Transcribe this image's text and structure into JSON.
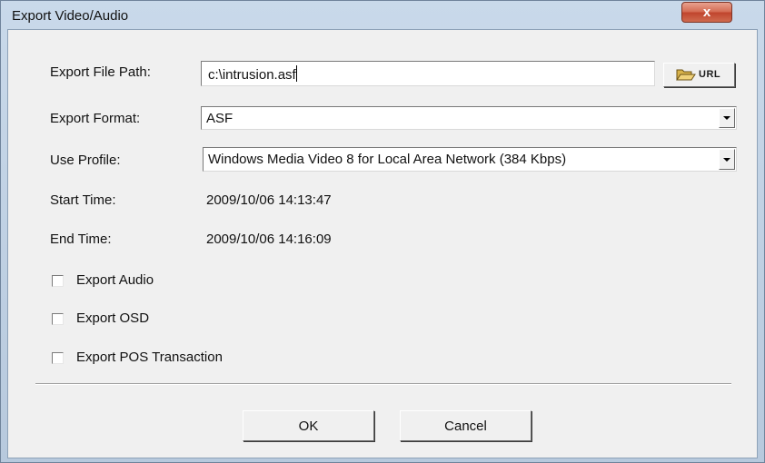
{
  "window": {
    "title": "Export Video/Audio",
    "close_glyph": "x"
  },
  "fields": {
    "export_file_path": {
      "label": "Export File Path:",
      "value": "c:\\intrusion.asf",
      "button_label": "URL",
      "button_icon": "folder-icon"
    },
    "export_format": {
      "label": "Export Format:",
      "selected": "ASF"
    },
    "use_profile": {
      "label": "Use Profile:",
      "selected": "Windows Media Video 8 for Local Area Network (384 Kbps)"
    },
    "start_time": {
      "label": "Start Time:",
      "value": "2009/10/06 14:13:47"
    },
    "end_time": {
      "label": "End Time:",
      "value": "2009/10/06 14:16:09"
    }
  },
  "options": [
    {
      "label": "Export Audio",
      "checked": false
    },
    {
      "label": "Export OSD",
      "checked": false
    },
    {
      "label": "Export POS Transaction",
      "checked": false
    }
  ],
  "buttons": {
    "ok": "OK",
    "cancel": "Cancel"
  }
}
